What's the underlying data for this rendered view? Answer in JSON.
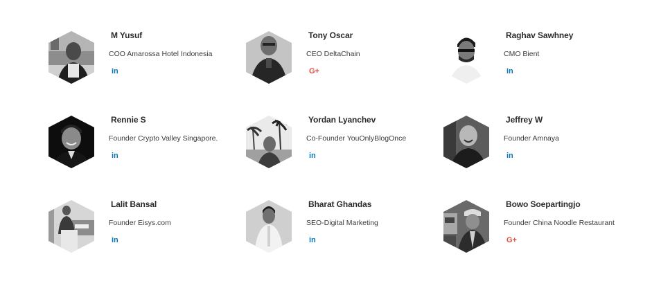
{
  "team": [
    {
      "name": "M Yusuf",
      "role": "COO Amarossa Hotel Indonesia",
      "social": "linkedin",
      "social_label": "in",
      "photo": "man-in-suit-at-table"
    },
    {
      "name": "Tony Oscar",
      "role": "CEO DeltaChain",
      "social": "google-plus",
      "social_label": "G+",
      "photo": "man-with-glasses-dark-jacket"
    },
    {
      "name": "Raghav Sawhney",
      "role": "CMO Bient",
      "social": "linkedin",
      "social_label": "in",
      "photo": "man-with-glasses-white-shirt"
    },
    {
      "name": "Rennie S",
      "role": "Founder Crypto Valley Singapore.",
      "social": "linkedin",
      "social_label": "in",
      "photo": "man-smiling-dark-background"
    },
    {
      "name": "Yordan Lyanchev",
      "role": "Co-Founder YouOnlyBlogOnce",
      "social": "linkedin",
      "social_label": "in",
      "photo": "man-with-palm-trees"
    },
    {
      "name": "Jeffrey W",
      "role": "Founder Amnaya",
      "social": "linkedin",
      "social_label": "in",
      "photo": "bald-man-smiling"
    },
    {
      "name": "Lalit Bansal",
      "role": "Founder Eisys.com",
      "social": "linkedin",
      "social_label": "in",
      "photo": "man-speaking-at-podium"
    },
    {
      "name": "Bharat Ghandas",
      "role": "SEO-Digital Marketing",
      "social": "linkedin",
      "social_label": "in",
      "photo": "man-white-shirt-office"
    },
    {
      "name": "Bowo Soepartingjo",
      "role": "Founder China Noodle Restaurant",
      "social": "google-plus",
      "social_label": "G+",
      "photo": "man-with-cap-outdoor"
    }
  ],
  "colors": {
    "linkedin": "#0a77b5",
    "google_plus": "#dd4b39",
    "name_text": "#2b2b2b",
    "role_text": "#3a3a3a",
    "background": "#ffffff"
  }
}
